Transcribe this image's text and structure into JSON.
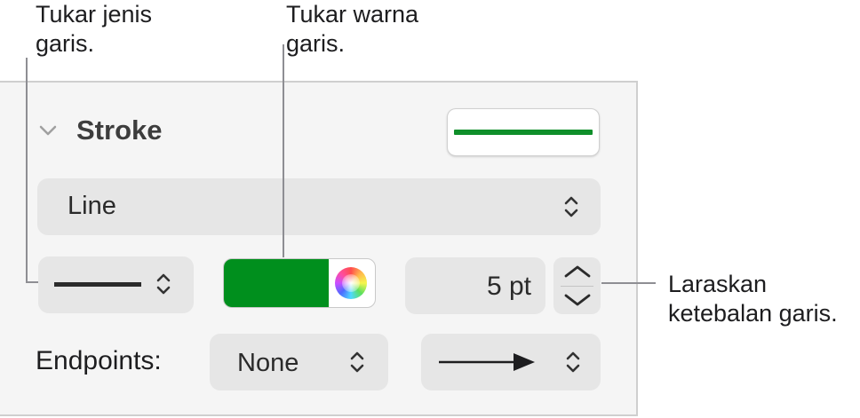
{
  "callouts": {
    "line_type": "Tukar jenis\ngaris.",
    "line_color": "Tukar warna\ngaris.",
    "thickness": "Laraskan\nketebalan garis."
  },
  "stroke": {
    "section_title": "Stroke",
    "style_popup": "Line",
    "color_hex": "#008f1d",
    "preview_line_color": "#0f8f2a",
    "width_value": "5 pt",
    "endpoints_label": "Endpoints:",
    "start_endpoint": "None"
  },
  "icons": {
    "disclosure": "chevron-down-icon",
    "popup": "up-down-chevron-icon",
    "color_wheel": "color-wheel-icon",
    "stepper": "stepper-icon",
    "arrow_endpoint": "arrow-right-icon"
  }
}
